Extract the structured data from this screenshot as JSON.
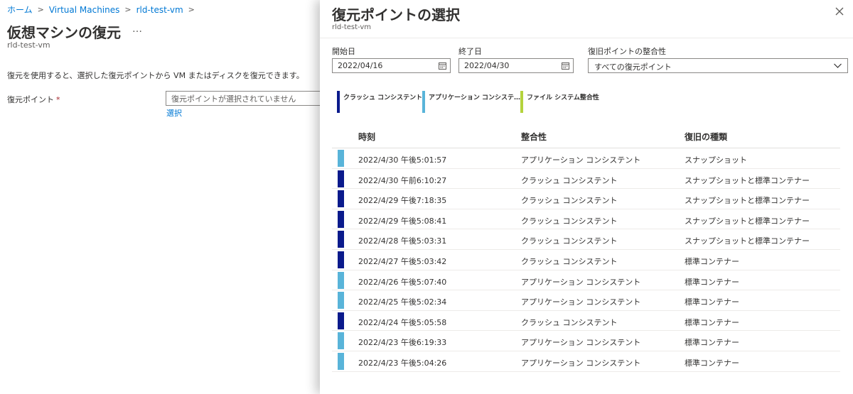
{
  "breadcrumb": {
    "items": [
      "ホーム",
      "Virtual Machines",
      "rld-test-vm"
    ]
  },
  "page": {
    "title": "仮想マシンの復元",
    "more": "…",
    "subtitle": "rld-test-vm",
    "description": "復元を使用すると、選択した復元ポイントから VM またはディスクを復元できます。",
    "restore_point_label": "復元ポイント",
    "required_mark": "*",
    "restore_point_placeholder": "復元ポイントが選択されていません",
    "select_link": "選択"
  },
  "blade": {
    "title": "復元ポイントの選択",
    "subtitle": "rld-test-vm",
    "filters": {
      "start_label": "開始日",
      "start_value": "2022/04/16",
      "end_label": "終了日",
      "end_value": "2022/04/30",
      "consistency_label": "復旧ポイントの整合性",
      "consistency_value": "すべての復元ポイント"
    },
    "legend": [
      {
        "label": "クラッシュ コンシステント",
        "color": "#0a1a8c"
      },
      {
        "label": "アプリケーション コンシステ…",
        "color": "#59b4d9"
      },
      {
        "label": "ファイル システム整合性",
        "color": "#b4d33c"
      }
    ],
    "table": {
      "headers": [
        "時刻",
        "整合性",
        "復旧の種類"
      ],
      "rows": [
        {
          "time": "2022/4/30 午後5:01:57",
          "consistency": "アプリケーション コンシステント",
          "type": "スナップショット",
          "color": "#59b4d9"
        },
        {
          "time": "2022/4/30 午前6:10:27",
          "consistency": "クラッシュ コンシステント",
          "type": "スナップショットと標準コンテナー",
          "color": "#0a1a8c"
        },
        {
          "time": "2022/4/29 午後7:18:35",
          "consistency": "クラッシュ コンシステント",
          "type": "スナップショットと標準コンテナー",
          "color": "#0a1a8c"
        },
        {
          "time": "2022/4/29 午後5:08:41",
          "consistency": "クラッシュ コンシステント",
          "type": "スナップショットと標準コンテナー",
          "color": "#0a1a8c"
        },
        {
          "time": "2022/4/28 午後5:03:31",
          "consistency": "クラッシュ コンシステント",
          "type": "スナップショットと標準コンテナー",
          "color": "#0a1a8c"
        },
        {
          "time": "2022/4/27 午後5:03:42",
          "consistency": "クラッシュ コンシステント",
          "type": "標準コンテナー",
          "color": "#0a1a8c"
        },
        {
          "time": "2022/4/26 午後5:07:40",
          "consistency": "アプリケーション コンシステント",
          "type": "標準コンテナー",
          "color": "#59b4d9"
        },
        {
          "time": "2022/4/25 午後5:02:34",
          "consistency": "アプリケーション コンシステント",
          "type": "標準コンテナー",
          "color": "#59b4d9"
        },
        {
          "time": "2022/4/24 午後5:05:58",
          "consistency": "クラッシュ コンシステント",
          "type": "標準コンテナー",
          "color": "#0a1a8c"
        },
        {
          "time": "2022/4/23 午後6:19:33",
          "consistency": "アプリケーション コンシステント",
          "type": "標準コンテナー",
          "color": "#59b4d9"
        },
        {
          "time": "2022/4/23 午後5:04:26",
          "consistency": "アプリケーション コンシステント",
          "type": "標準コンテナー",
          "color": "#59b4d9"
        }
      ]
    }
  },
  "colors": {
    "link": "#0078d4",
    "crash": "#0a1a8c",
    "application": "#59b4d9",
    "filesystem": "#b4d33c"
  }
}
